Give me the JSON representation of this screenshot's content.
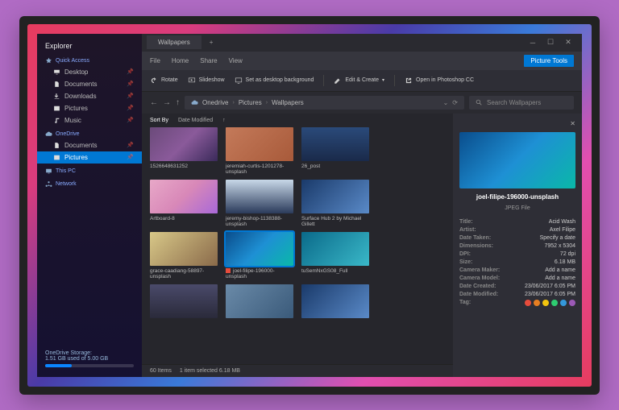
{
  "app_title": "Explorer",
  "sidebar": {
    "sections": [
      {
        "label": "Quick Access",
        "icon": "star",
        "items": [
          {
            "label": "Desktop",
            "icon": "desktop"
          },
          {
            "label": "Documents",
            "icon": "doc"
          },
          {
            "label": "Downloads",
            "icon": "download"
          },
          {
            "label": "Pictures",
            "icon": "picture"
          },
          {
            "label": "Music",
            "icon": "music"
          }
        ]
      },
      {
        "label": "OneDrive",
        "icon": "cloud",
        "items": [
          {
            "label": "Documents",
            "icon": "doc"
          },
          {
            "label": "Pictures",
            "icon": "picture",
            "active": true
          }
        ]
      },
      {
        "label": "This PC",
        "icon": "pc",
        "items": []
      },
      {
        "label": "Network",
        "icon": "network",
        "items": []
      }
    ],
    "storage": {
      "label": "OneDrive Storage:",
      "text": "1.51 GB used of 5.00 GB",
      "percent": 30
    }
  },
  "tabs": {
    "active": "Wallpapers"
  },
  "ribbon_tabs": [
    "File",
    "Home",
    "Share",
    "View"
  ],
  "picture_tools": "Picture Tools",
  "ribbon": {
    "rotate": "Rotate",
    "slideshow": "Slideshow",
    "setbg": "Set as desktop background",
    "edit": "Edit & Create",
    "openps": "Open in Photoshop CC"
  },
  "breadcrumb": [
    "Onedrive",
    "Pictures",
    "Wallpapers"
  ],
  "search_placeholder": "Search Wallpapers",
  "sort": {
    "by": "Sort By",
    "date": "Date Modified"
  },
  "items": [
    {
      "name": "1526648631252",
      "g": "g1"
    },
    {
      "name": "jeremiah-curtis-1201278-unsplash",
      "g": "g2"
    },
    {
      "name": "26_post",
      "g": "g3"
    },
    {
      "name": "",
      "g": ""
    },
    {
      "name": "Artboard-8",
      "g": "g4"
    },
    {
      "name": "jeremy-bishop-1138388-unsplash",
      "g": "g5"
    },
    {
      "name": "Surface Hub 2 by Michael Gillett",
      "g": "g6"
    },
    {
      "name": "",
      "g": ""
    },
    {
      "name": "grace-caadiang-58897-unsplash",
      "g": "g7"
    },
    {
      "name": "joel-filipe-196000-unsplash",
      "g": "g8",
      "selected": true
    },
    {
      "name": "tuSemNxGS08_Full",
      "g": "g9"
    },
    {
      "name": "",
      "g": ""
    },
    {
      "name": "",
      "g": "g10"
    },
    {
      "name": "",
      "g": "g11"
    },
    {
      "name": "",
      "g": "g6"
    },
    {
      "name": "",
      "g": ""
    }
  ],
  "status": {
    "count": "60 Items",
    "selection": "1 item selected 6.18 MB"
  },
  "details": {
    "filename": "joel-filipe-196000-unsplash",
    "filetype": "JPEG File",
    "meta": [
      {
        "k": "Title:",
        "v": "Acid Wash"
      },
      {
        "k": "Artist:",
        "v": "Axel Filipe"
      },
      {
        "k": "Date Taken:",
        "v": "Specify a date"
      },
      {
        "k": "Dimensions:",
        "v": "7952 x 5304"
      },
      {
        "k": "DPI:",
        "v": "72 dpi"
      },
      {
        "k": "Size:",
        "v": "6.18 MB"
      },
      {
        "k": "Camera Maker:",
        "v": "Add a name"
      },
      {
        "k": "Camera Model:",
        "v": "Add a name"
      },
      {
        "k": "Date Created:",
        "v": "23/06/2017 6:05 PM"
      },
      {
        "k": "Date Modified:",
        "v": "23/06/2017 6:05 PM"
      }
    ],
    "tag_label": "Tag:",
    "tag_colors": [
      "#e74c3c",
      "#e67e22",
      "#f1c40f",
      "#2ecc71",
      "#3498db",
      "#9b59b6"
    ]
  }
}
